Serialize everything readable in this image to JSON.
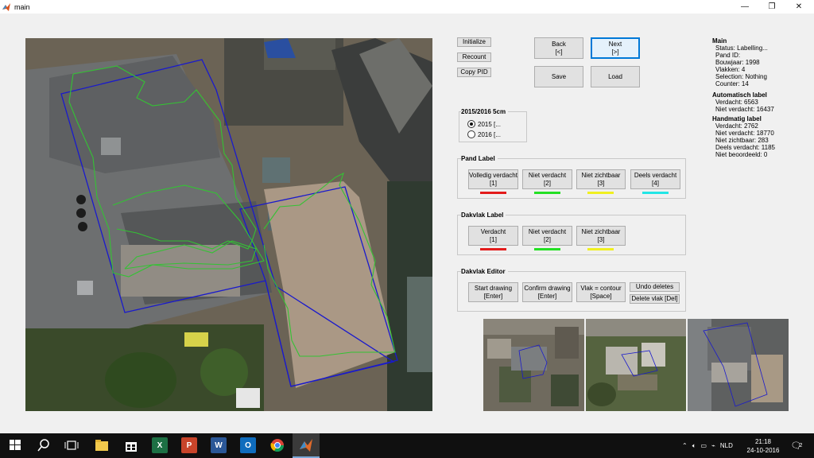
{
  "window": {
    "title": "main",
    "minimize": "—",
    "maximize": "❐",
    "close": "✕"
  },
  "toolbar": {
    "initialize": "Initialize",
    "recount": "Recount",
    "copy_pid": "Copy PID"
  },
  "nav": {
    "back_label": "Back",
    "back_key": "[<]",
    "next_label": "Next",
    "next_key": "[>]",
    "save_label": "Save",
    "load_label": "Load"
  },
  "year_panel": {
    "title": "2015/2016 5cm",
    "options": [
      "2015 [...",
      "2016 [..."
    ],
    "selected": "2015 [..."
  },
  "pand_label": {
    "title": "Pand Label",
    "buttons": [
      {
        "label": "Volledig verdacht",
        "key": "[1]",
        "color": "#e31b1b"
      },
      {
        "label": "Niet verdacht",
        "key": "[2]",
        "color": "#23e023"
      },
      {
        "label": "Niet zichtbaar",
        "key": "[3]",
        "color": "#f0f020"
      },
      {
        "label": "Deels verdacht",
        "key": "[4]",
        "color": "#22e6e6"
      }
    ]
  },
  "dakvlak_label": {
    "title": "Dakvlak Label",
    "buttons": [
      {
        "label": "Verdacht",
        "key": "[1]",
        "color": "#e31b1b"
      },
      {
        "label": "Niet verdacht",
        "key": "[2]",
        "color": "#23e023"
      },
      {
        "label": "Niet zichtbaar",
        "key": "[3]",
        "color": "#f0f020"
      }
    ]
  },
  "dakvlak_editor": {
    "title": "Dakvlak Editor",
    "start_label": "Start drawing",
    "start_key": "[Enter]",
    "confirm_label": "Confirm drawing",
    "confirm_key": "[Enter]",
    "contour_label": "Vlak = contour",
    "contour_key": "[Space]",
    "undo_label": "Undo deletes",
    "delete_label": "Delete vlak [Del]"
  },
  "info": {
    "main_title": "Main",
    "main_lines": [
      "Status: Labelling...",
      "Pand ID:",
      "Bouwjaar: 1998",
      "Vlakken: 4",
      "Selection: Nothing",
      "Counter: 14"
    ],
    "auto_title": "Automatisch label",
    "auto_lines": [
      "Verdacht: 6563",
      "Niet verdacht: 16437"
    ],
    "hand_title": "Handmatig label",
    "hand_lines": [
      "Verdacht: 2762",
      "Niet verdacht: 18770",
      "Niet zichtbaar: 283",
      "Deels verdacht: 1185",
      "Niet beoordeeld: 0"
    ]
  },
  "colors": {
    "outline_blue": "#1a1acc",
    "outline_green": "#34c234",
    "focus": "#0078d7"
  },
  "taskbar": {
    "apps": [
      "start-icon",
      "search-icon",
      "task-view-icon",
      "file-explorer-icon",
      "store-icon",
      "excel-icon",
      "powerpoint-icon",
      "word-icon",
      "outlook-icon",
      "chrome-icon",
      "matlab-icon"
    ],
    "excel": "X",
    "powerpoint": "P",
    "word": "W",
    "outlook": "O",
    "language": "NLD",
    "time": "21:18",
    "date": "24-10-2016",
    "notifications": "2"
  }
}
